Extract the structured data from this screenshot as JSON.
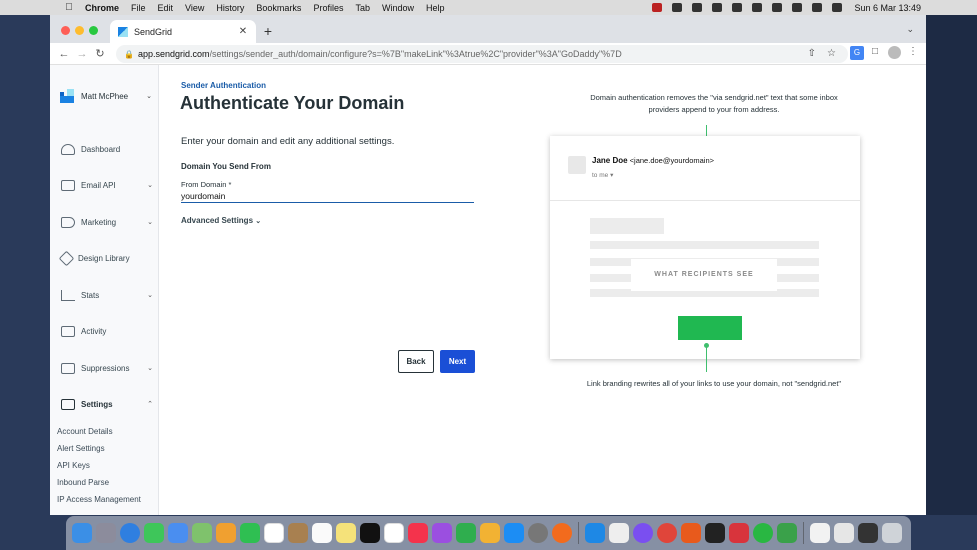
{
  "menubar": {
    "app_name": "Chrome",
    "items": [
      "File",
      "Edit",
      "View",
      "History",
      "Bookmarks",
      "Profiles",
      "Tab",
      "Window",
      "Help"
    ],
    "clock": "Sun 6 Mar  13:49"
  },
  "browser": {
    "tab_title": "SendGrid",
    "url_host": "app.sendgrid.com",
    "url_path": "/settings/sender_auth/domain/configure?s=%7B\"makeLink\"%3Atrue%2C\"provider\"%3A\"GoDaddy\"%7D"
  },
  "sidebar": {
    "account_name": "Matt McPhee",
    "items": [
      {
        "label": "Dashboard",
        "icon": "dashboard-icon"
      },
      {
        "label": "Email API",
        "icon": "email-api-icon"
      },
      {
        "label": "Marketing",
        "icon": "marketing-icon"
      },
      {
        "label": "Design Library",
        "icon": "design-library-icon"
      },
      {
        "label": "Stats",
        "icon": "stats-icon"
      },
      {
        "label": "Activity",
        "icon": "activity-icon"
      },
      {
        "label": "Suppressions",
        "icon": "suppressions-icon"
      },
      {
        "label": "Settings",
        "icon": "settings-icon"
      }
    ],
    "subitems": [
      "Account Details",
      "Alert Settings",
      "API Keys",
      "Inbound Parse",
      "IP Access Management"
    ]
  },
  "main": {
    "breadcrumb": "Sender Authentication",
    "title": "Authenticate Your Domain",
    "intro": "Enter your domain and edit any additional settings.",
    "section_title": "Domain You Send From",
    "field_label": "From Domain",
    "field_required": "*",
    "field_value": "yourdomain",
    "advanced_settings": "Advanced Settings",
    "back_label": "Back",
    "next_label": "Next"
  },
  "illustration": {
    "top_caption_line1": "Domain authentication removes the \"via sendgrid.net\" text that some inbox",
    "top_caption_line2": "providers append to your from address.",
    "sender_name": "Jane Doe",
    "sender_email": "<jane.doe@yourdomain>",
    "to_line": "to me",
    "center_caption": "WHAT RECIPIENTS SEE",
    "bottom_caption": "Link branding rewrites all of your links to use your domain, not \"sendgrid.net\""
  },
  "colors": {
    "brand_blue": "#1a4fd6",
    "breadcrumb_blue": "#1a5ca8",
    "accent_green": "#20b851"
  }
}
